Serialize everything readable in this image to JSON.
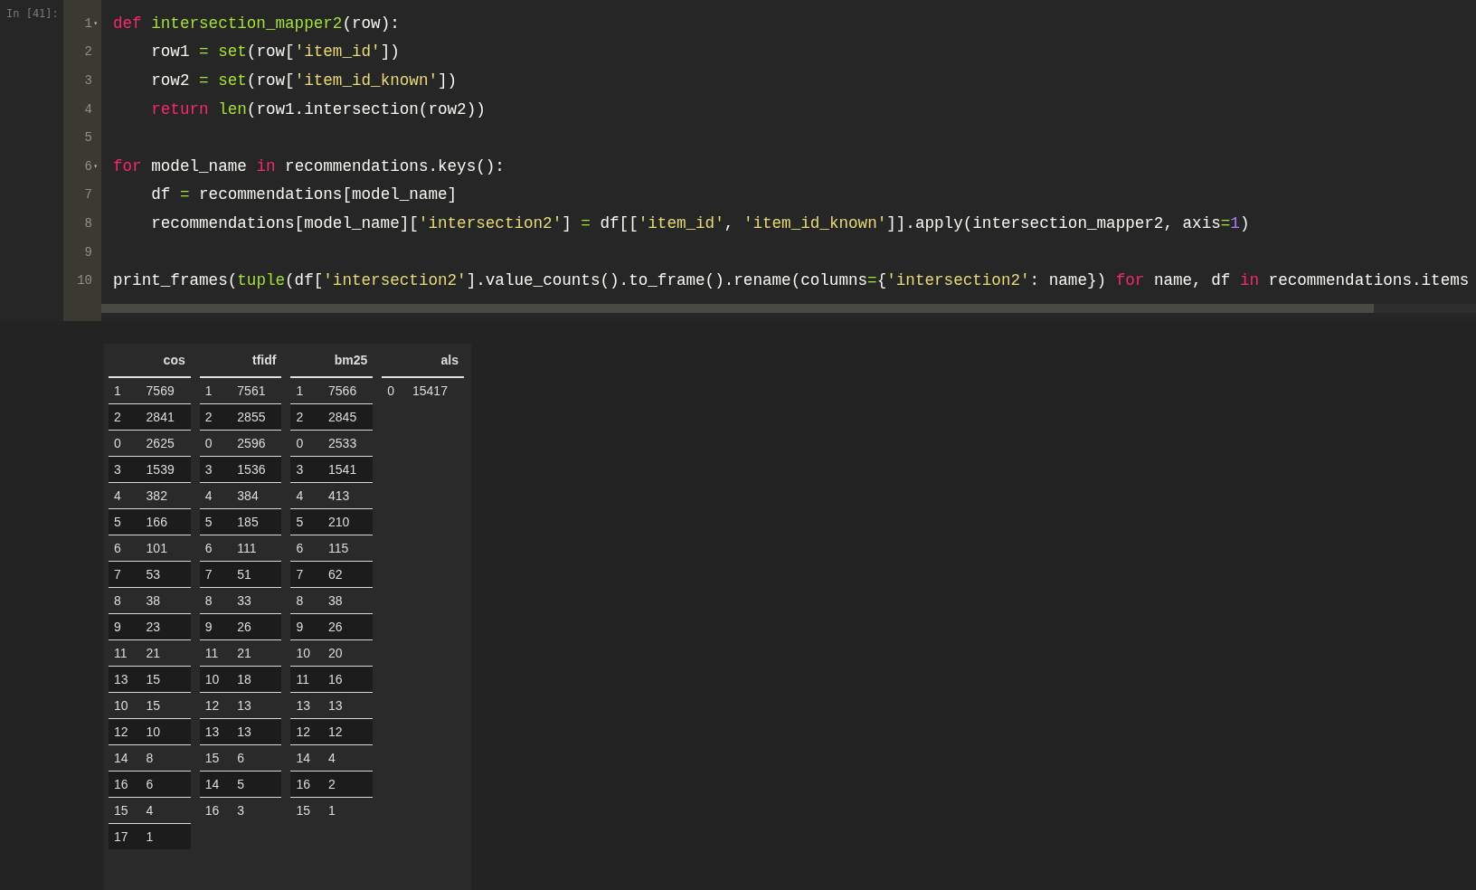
{
  "cell": {
    "prompt": "In [41]:",
    "lines": [
      {
        "number": "1",
        "fold": "▾",
        "tokens": [
          {
            "kind": "keyword",
            "text": "def "
          },
          {
            "kind": "builtin",
            "text": "intersection_mapper2"
          },
          {
            "kind": "plain",
            "text": "(row):"
          }
        ]
      },
      {
        "number": "2",
        "tokens": [
          {
            "kind": "plain",
            "text": "    row1 "
          },
          {
            "kind": "builtin",
            "text": "= "
          },
          {
            "kind": "builtin",
            "text": "set"
          },
          {
            "kind": "plain",
            "text": "(row["
          },
          {
            "kind": "string",
            "text": "'item_id'"
          },
          {
            "kind": "plain",
            "text": "])"
          }
        ]
      },
      {
        "number": "3",
        "tokens": [
          {
            "kind": "plain",
            "text": "    row2 "
          },
          {
            "kind": "builtin",
            "text": "= "
          },
          {
            "kind": "builtin",
            "text": "set"
          },
          {
            "kind": "plain",
            "text": "(row["
          },
          {
            "kind": "string",
            "text": "'item_id_known'"
          },
          {
            "kind": "plain",
            "text": "])"
          }
        ]
      },
      {
        "number": "4",
        "tokens": [
          {
            "kind": "keyword",
            "text": "    return "
          },
          {
            "kind": "builtin",
            "text": "len"
          },
          {
            "kind": "plain",
            "text": "(row1.intersection(row2))"
          }
        ]
      },
      {
        "number": "5"
      },
      {
        "number": "6",
        "fold": "▾",
        "tokens": [
          {
            "kind": "keyword",
            "text": "for"
          },
          {
            "kind": "plain",
            "text": " model_name "
          },
          {
            "kind": "keyword",
            "text": "in"
          },
          {
            "kind": "plain",
            "text": " recommendations.keys():"
          }
        ]
      },
      {
        "number": "7",
        "tokens": [
          {
            "kind": "plain",
            "text": "    df "
          },
          {
            "kind": "builtin",
            "text": "="
          },
          {
            "kind": "plain",
            "text": " recommendations[model_name]"
          }
        ]
      },
      {
        "number": "8",
        "tokens": [
          {
            "kind": "plain",
            "text": "    recommendations[model_name]["
          },
          {
            "kind": "string",
            "text": "'intersection2'"
          },
          {
            "kind": "plain",
            "text": "] "
          },
          {
            "kind": "builtin",
            "text": "="
          },
          {
            "kind": "plain",
            "text": " df[["
          },
          {
            "kind": "string",
            "text": "'item_id'"
          },
          {
            "kind": "plain",
            "text": ", "
          },
          {
            "kind": "string",
            "text": "'item_id_known'"
          },
          {
            "kind": "plain",
            "text": "]].apply(intersection_mapper2, axis"
          },
          {
            "kind": "builtin",
            "text": "="
          },
          {
            "kind": "number",
            "text": "1"
          },
          {
            "kind": "plain",
            "text": ")"
          }
        ]
      },
      {
        "number": "9"
      },
      {
        "number": "10",
        "tokens": [
          {
            "kind": "plain",
            "text": "print_frames("
          },
          {
            "kind": "builtin",
            "text": "tuple"
          },
          {
            "kind": "plain",
            "text": "(df["
          },
          {
            "kind": "string",
            "text": "'intersection2'"
          },
          {
            "kind": "plain",
            "text": "].value_counts().to_frame().rename(columns"
          },
          {
            "kind": "builtin",
            "text": "="
          },
          {
            "kind": "plain",
            "text": "{"
          },
          {
            "kind": "string",
            "text": "'intersection2'"
          },
          {
            "kind": "plain",
            "text": ": name}) "
          },
          {
            "kind": "keyword",
            "text": "for"
          },
          {
            "kind": "plain",
            "text": " name, df "
          },
          {
            "kind": "keyword",
            "text": "in"
          },
          {
            "kind": "plain",
            "text": " recommendations.items"
          }
        ]
      }
    ]
  },
  "output": {
    "tables": [
      {
        "header": "cos",
        "rows": [
          [
            "1",
            "7569"
          ],
          [
            "2",
            "2841"
          ],
          [
            "0",
            "2625"
          ],
          [
            "3",
            "1539"
          ],
          [
            "4",
            "382"
          ],
          [
            "5",
            "166"
          ],
          [
            "6",
            "101"
          ],
          [
            "7",
            "53"
          ],
          [
            "8",
            "38"
          ],
          [
            "9",
            "23"
          ],
          [
            "11",
            "21"
          ],
          [
            "13",
            "15"
          ],
          [
            "10",
            "15"
          ],
          [
            "12",
            "10"
          ],
          [
            "14",
            "8"
          ],
          [
            "16",
            "6"
          ],
          [
            "15",
            "4"
          ],
          [
            "17",
            "1"
          ]
        ]
      },
      {
        "header": "tfidf",
        "rows": [
          [
            "1",
            "7561"
          ],
          [
            "2",
            "2855"
          ],
          [
            "0",
            "2596"
          ],
          [
            "3",
            "1536"
          ],
          [
            "4",
            "384"
          ],
          [
            "5",
            "185"
          ],
          [
            "6",
            "111"
          ],
          [
            "7",
            "51"
          ],
          [
            "8",
            "33"
          ],
          [
            "9",
            "26"
          ],
          [
            "11",
            "21"
          ],
          [
            "10",
            "18"
          ],
          [
            "12",
            "13"
          ],
          [
            "13",
            "13"
          ],
          [
            "15",
            "6"
          ],
          [
            "14",
            "5"
          ],
          [
            "16",
            "3"
          ]
        ]
      },
      {
        "header": "bm25",
        "rows": [
          [
            "1",
            "7566"
          ],
          [
            "2",
            "2845"
          ],
          [
            "0",
            "2533"
          ],
          [
            "3",
            "1541"
          ],
          [
            "4",
            "413"
          ],
          [
            "5",
            "210"
          ],
          [
            "6",
            "115"
          ],
          [
            "7",
            "62"
          ],
          [
            "8",
            "38"
          ],
          [
            "9",
            "26"
          ],
          [
            "10",
            "20"
          ],
          [
            "11",
            "16"
          ],
          [
            "13",
            "13"
          ],
          [
            "12",
            "12"
          ],
          [
            "14",
            "4"
          ],
          [
            "16",
            "2"
          ],
          [
            "15",
            "1"
          ]
        ]
      },
      {
        "header": "als",
        "rows": [
          [
            "0",
            "15417"
          ]
        ]
      }
    ]
  }
}
